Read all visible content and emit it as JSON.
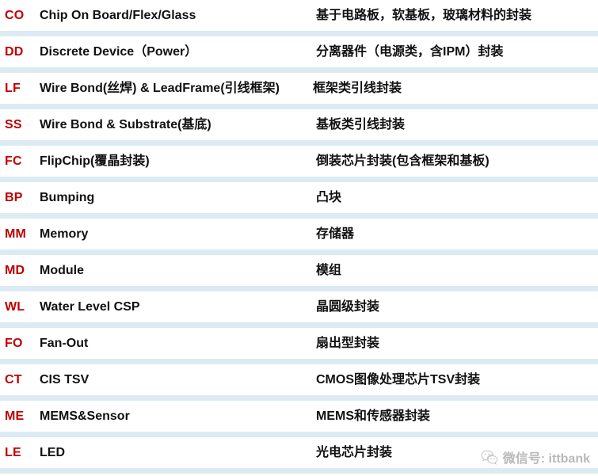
{
  "table": {
    "columns": [
      "code",
      "english",
      "chinese"
    ],
    "rows": [
      {
        "code": "CO",
        "english": "Chip On Board/Flex/Glass",
        "chinese": "基于电路板，软基板，玻璃材料的封装"
      },
      {
        "code": "DD",
        "english": "Discrete Device（Power）",
        "chinese": "分离器件（电源类，含IPM）封装"
      },
      {
        "code": "LF",
        "english": "Wire Bond(丝焊) & LeadFrame(引线框架)",
        "chinese": "框架类引线封装"
      },
      {
        "code": "SS",
        "english": "Wire Bond & Substrate(基底)",
        "chinese": "基板类引线封装"
      },
      {
        "code": "FC",
        "english": "FlipChip(覆晶封装)",
        "chinese": "倒装芯片封装(包含框架和基板)"
      },
      {
        "code": "BP",
        "english": "Bumping",
        "chinese": "凸块"
      },
      {
        "code": "MM",
        "english": "Memory",
        "chinese": "存储器"
      },
      {
        "code": "MD",
        "english": "Module",
        "chinese": "模组"
      },
      {
        "code": "WL",
        "english": "Water Level CSP",
        "chinese": "晶圆级封装"
      },
      {
        "code": "FO",
        "english": "Fan-Out",
        "chinese": "扇出型封装"
      },
      {
        "code": "CT",
        "english": "CIS TSV",
        "chinese": "CMOS图像处理芯片TSV封装"
      },
      {
        "code": "ME",
        "english": "MEMS&Sensor",
        "chinese": "MEMS和传感器封装"
      },
      {
        "code": "LE",
        "english": "LED",
        "chinese": "光电芯片封装"
      }
    ]
  },
  "watermark": {
    "icon": "wechat-icon",
    "text": "微信号: ittbank"
  },
  "colors": {
    "code_red": "#c00000",
    "stripe_blue": "#dcebf3",
    "text_black": "#111111",
    "watermark_gray": "#b9b9b9",
    "background": "#ffffff"
  }
}
